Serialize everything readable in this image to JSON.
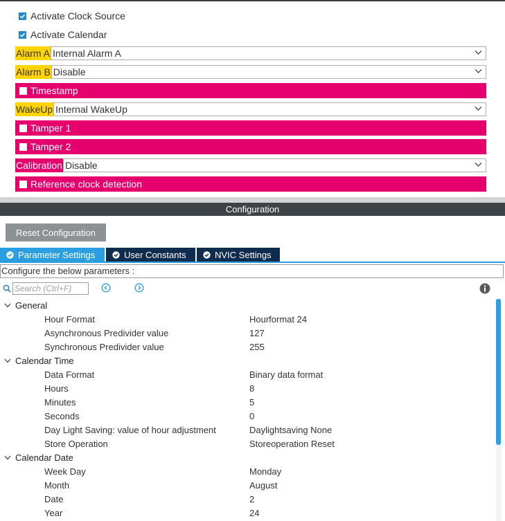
{
  "mode": {
    "activate_clock_source": {
      "label": "Activate Clock Source",
      "checked": true
    },
    "activate_calendar": {
      "label": "Activate Calendar",
      "checked": true
    },
    "alarm_a": {
      "label": "Alarm A",
      "value": "Internal Alarm A"
    },
    "alarm_b": {
      "label": "Alarm B",
      "value": "Disable"
    },
    "timestamp": {
      "label": "Timestamp",
      "checked": false
    },
    "wakeup": {
      "label": "WakeUp",
      "value": "Internal WakeUp"
    },
    "tamper1": {
      "label": "Tamper 1",
      "checked": false
    },
    "tamper2": {
      "label": "Tamper 2",
      "checked": false
    },
    "calibration": {
      "label": "Calibration",
      "value": "Disable"
    },
    "reference_clock": {
      "label": "Reference clock detection",
      "checked": false
    }
  },
  "configuration": {
    "title": "Configuration",
    "reset_button": "Reset Configuration",
    "tabs": [
      {
        "label": "Parameter Settings",
        "active": true
      },
      {
        "label": "User Constants",
        "active": false
      },
      {
        "label": "NVIC Settings",
        "active": false
      }
    ],
    "configure_text": "Configure the below parameters :",
    "search_placeholder": "Search (Ctrl+F)"
  },
  "parameters": {
    "general": {
      "label": "General",
      "items": [
        {
          "name": "Hour Format",
          "value": "Hourformat 24"
        },
        {
          "name": "Asynchronous Predivider value",
          "value": "127"
        },
        {
          "name": "Synchronous Predivider value",
          "value": "255"
        }
      ]
    },
    "calendar_time": {
      "label": "Calendar Time",
      "items": [
        {
          "name": "Data Format",
          "value": "Binary data format"
        },
        {
          "name": "Hours",
          "value": "8"
        },
        {
          "name": "Minutes",
          "value": "5"
        },
        {
          "name": "Seconds",
          "value": "0"
        },
        {
          "name": "Day Light Saving: value of hour adjustment",
          "value": "Daylightsaving None"
        },
        {
          "name": "Store Operation",
          "value": "Storeoperation Reset"
        }
      ]
    },
    "calendar_date": {
      "label": "Calendar Date",
      "items": [
        {
          "name": "Week Day",
          "value": "Monday"
        },
        {
          "name": "Month",
          "value": "August"
        },
        {
          "name": "Date",
          "value": "2"
        },
        {
          "name": "Year",
          "value": "24"
        }
      ]
    }
  },
  "colors": {
    "pin_highlight_pink": "#e5006e",
    "label_highlight_yellow": "#ffd400",
    "accent_blue": "#2b9fe0",
    "tab_dark": "#0f2c4e"
  }
}
